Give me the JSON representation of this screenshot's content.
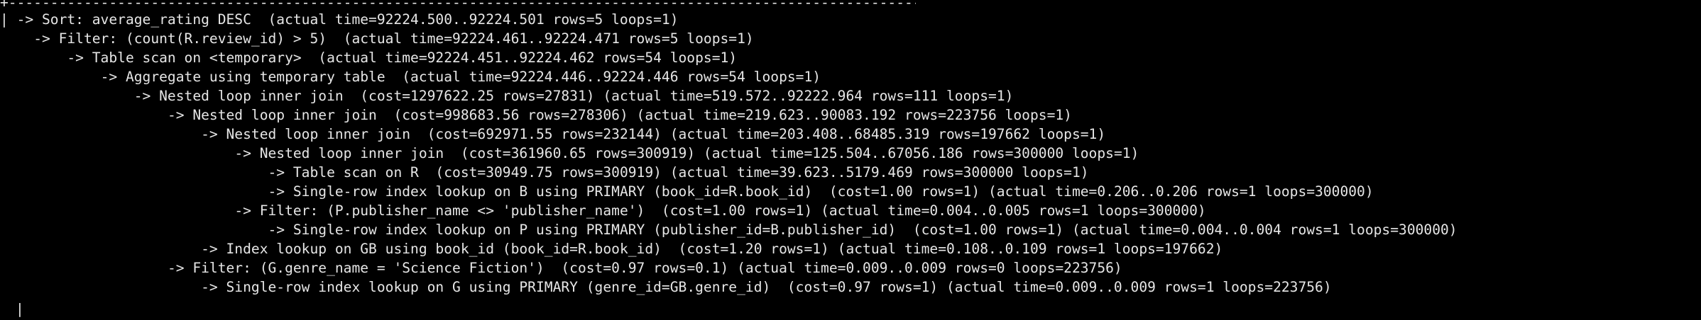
{
  "terminal": {
    "border_top": "+---------------------------------------------------------------------------------------------------------------------------------------------------------------------------------------------------------------------------------------------------------------------------------------------------------------------------------------------------------------------------------------------------------------------------------+",
    "row_prefix": "|",
    "cursor_text": "|",
    "plan_lines": [
      {
        "indent": "",
        "text": " -> Sort: average_rating DESC  (actual time=92224.500..92224.501 rows=5 loops=1)"
      },
      {
        "indent": "    ",
        "text": "-> Filter: (count(R.review_id) > 5)  (actual time=92224.461..92224.471 rows=5 loops=1)"
      },
      {
        "indent": "        ",
        "text": "-> Table scan on <temporary>  (actual time=92224.451..92224.462 rows=54 loops=1)"
      },
      {
        "indent": "            ",
        "text": "-> Aggregate using temporary table  (actual time=92224.446..92224.446 rows=54 loops=1)"
      },
      {
        "indent": "                ",
        "text": "-> Nested loop inner join  (cost=1297622.25 rows=27831) (actual time=519.572..92222.964 rows=111 loops=1)"
      },
      {
        "indent": "                    ",
        "text": "-> Nested loop inner join  (cost=998683.56 rows=278306) (actual time=219.623..90083.192 rows=223756 loops=1)"
      },
      {
        "indent": "                        ",
        "text": "-> Nested loop inner join  (cost=692971.55 rows=232144) (actual time=203.408..68485.319 rows=197662 loops=1)"
      },
      {
        "indent": "                            ",
        "text": "-> Nested loop inner join  (cost=361960.65 rows=300919) (actual time=125.504..67056.186 rows=300000 loops=1)"
      },
      {
        "indent": "                                ",
        "text": "-> Table scan on R  (cost=30949.75 rows=300919) (actual time=39.623..5179.469 rows=300000 loops=1)"
      },
      {
        "indent": "                                ",
        "text": "-> Single-row index lookup on B using PRIMARY (book_id=R.book_id)  (cost=1.00 rows=1) (actual time=0.206..0.206 rows=1 loops=300000)"
      },
      {
        "indent": "                            ",
        "text": "-> Filter: (P.publisher_name <> 'publisher_name')  (cost=1.00 rows=1) (actual time=0.004..0.005 rows=1 loops=300000)"
      },
      {
        "indent": "                                ",
        "text": "-> Single-row index lookup on P using PRIMARY (publisher_id=B.publisher_id)  (cost=1.00 rows=1) (actual time=0.004..0.004 rows=1 loops=300000)"
      },
      {
        "indent": "                        ",
        "text": "-> Index lookup on GB using book_id (book_id=R.book_id)  (cost=1.20 rows=1) (actual time=0.108..0.109 rows=1 loops=197662)"
      },
      {
        "indent": "                    ",
        "text": "-> Filter: (G.genre_name = 'Science Fiction')  (cost=0.97 rows=0.1) (actual time=0.009..0.009 rows=0 loops=223756)"
      },
      {
        "indent": "                        ",
        "text": "-> Single-row index lookup on G using PRIMARY (genre_id=GB.genre_id)  (cost=0.97 rows=1) (actual time=0.009..0.009 rows=1 loops=223756)"
      }
    ]
  },
  "colors": {
    "background": "#000000",
    "text": "#e6e6e6"
  }
}
